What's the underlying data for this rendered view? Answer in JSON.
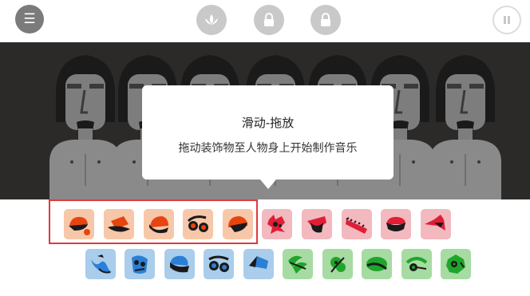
{
  "toolbar": {
    "menu_icon": "menu-icon",
    "modes": [
      "lotus-icon",
      "lock-icon",
      "lock-icon"
    ],
    "pause_icon": "pause-icon"
  },
  "tooltip": {
    "title": "滑动-拖放",
    "text": "拖动装饰物至人物身上开始制作音乐"
  },
  "colors": {
    "beats": "#f7c7a9",
    "effects": "#f2b9bf",
    "melodies": "#a9cdea",
    "voices": "#a6dba2",
    "highlight": "#e0393e"
  },
  "icons": {
    "beats": [
      "cap-icon",
      "hat-icon",
      "beanie-icon",
      "goggles-icon",
      "helmet-icon"
    ],
    "effects": [
      "mask-icon",
      "hat-icon",
      "headband-icon",
      "cap-icon",
      "bird-hat-icon"
    ],
    "melodies": [
      "hair-icon",
      "mask-icon",
      "cap-icon",
      "goggles-icon",
      "hat-icon"
    ],
    "voices": [
      "leaf-icon",
      "leaves-icon",
      "visor-icon",
      "headphones-icon",
      "mask-icon"
    ]
  }
}
